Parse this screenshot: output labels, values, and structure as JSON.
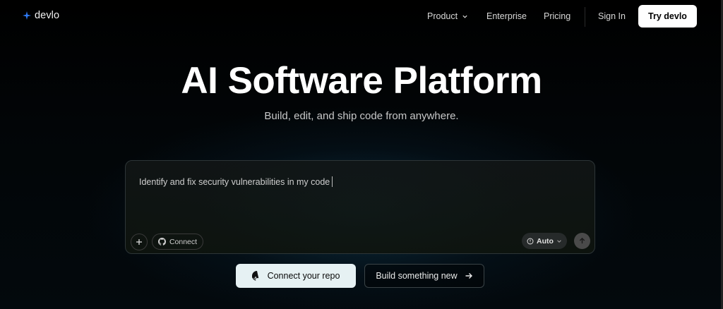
{
  "brand": {
    "name": "devlo",
    "accent": "#2f7bf6"
  },
  "nav": {
    "product": "Product",
    "enterprise": "Enterprise",
    "pricing": "Pricing",
    "sign_in": "Sign In",
    "try": "Try devlo"
  },
  "hero": {
    "title": "AI Software Platform",
    "subtitle": "Build, edit, and ship code from anywhere."
  },
  "prompt": {
    "text": "Identify and fix security vulnerabilities in my code",
    "connect_label": "Connect",
    "mode_label": "Auto"
  },
  "cta": {
    "repo_label": "Connect your repo",
    "new_label": "Build something new"
  }
}
